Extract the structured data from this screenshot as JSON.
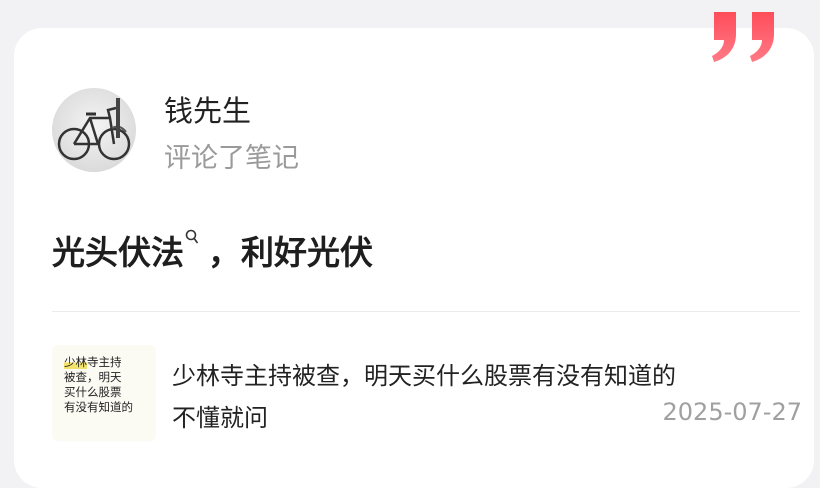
{
  "user": {
    "name": "钱先生",
    "action": "评论了笔记"
  },
  "comment": {
    "before": "光头伏法",
    "after": "，利好光伏",
    "search_icon": "search-icon"
  },
  "note": {
    "thumb_lines": [
      "少林寺主持",
      "被查，明天",
      "买什么股票",
      "有没有知道的"
    ],
    "thumb_highlight": "少林",
    "title_line1": "少林寺主持被查，明天买什么股票有没有知道的",
    "title_line2": "不懂就问",
    "date": "2025-07-27"
  },
  "colors": {
    "accent_quote": "#ff3b4a",
    "text_primary": "#222222",
    "text_secondary": "#9a9a9a"
  },
  "icons": {
    "quote": "quote-icon",
    "avatar": "bicycle-avatar"
  }
}
